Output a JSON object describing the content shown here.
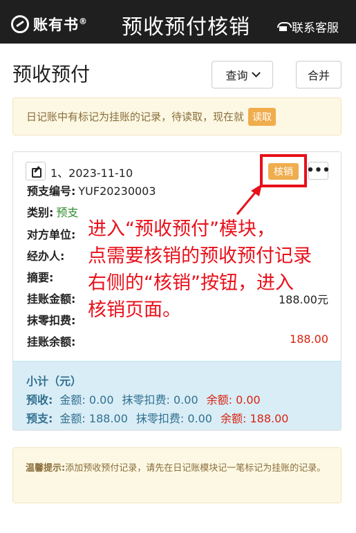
{
  "header": {
    "logo_text": "账有书",
    "logo_mark": "®",
    "title": "预收预付核销",
    "service": "联系客服"
  },
  "page": {
    "title": "预收预付",
    "query_label": "查询",
    "merge_label": "合并"
  },
  "notice": {
    "text": "日记账中有标记为挂账的记录，待读取，现在就",
    "read_label": "读取"
  },
  "record": {
    "index_date": "1、2023-11-10",
    "hx_label": "核销",
    "more_label": "•••",
    "fields": {
      "bill_no_label": "预支编号:",
      "bill_no": "YUF20230003",
      "type_label": "类别:",
      "type": "预支",
      "counterparty_label": "对方单位:",
      "handler_label": "经办人:",
      "summary_label": "摘要:",
      "amount_label": "挂账金额:",
      "amount": "188.00元",
      "rounding_label": "抹零扣费:",
      "balance_label": "挂账余额:",
      "balance": "188.00"
    }
  },
  "annotation": {
    "line1": "进入“预收预付”模块，",
    "line2": "点需要核销的预收预付记录",
    "line3": "右侧的“核销”按钮，进入",
    "line4": "核销页面。"
  },
  "subtotal": {
    "title": "小计（元）",
    "receive": {
      "label": "预收:",
      "amount": "金额: 0.00",
      "rounding": "抹零扣费: 0.00",
      "balance": "余额: 0.00"
    },
    "prepay": {
      "label": "预支:",
      "amount": "金额: 188.00",
      "rounding": "抹零扣费: 0.00",
      "balance": "余额: 188.00"
    }
  },
  "tip": {
    "label": "温馨提示:",
    "text": "添加预收预付记录，请先在日记账模块记一笔标记为挂账的记录。"
  },
  "colors": {
    "topbar": "#1f1f1f",
    "accent_orange": "#f0ad4e",
    "annotation_red": "#e8101a",
    "summary_blue": "#d9edf7"
  }
}
